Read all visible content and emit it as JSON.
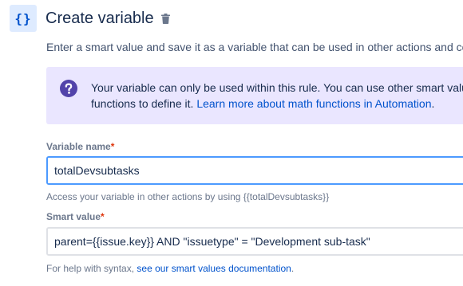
{
  "header": {
    "icon_glyph": "{}",
    "icon_name": "variable-icon",
    "title": "Create variable",
    "delete_icon": "trash-icon"
  },
  "description": "Enter a smart value and save it as a variable that can be used in other actions and co",
  "info": {
    "icon": "question-icon",
    "line1": "Your variable can only be used within this rule. You can use other smart valu",
    "line2_prefix": "functions to define it. ",
    "link_text": "Learn more about math functions in Automation",
    "line2_suffix": "."
  },
  "fields": {
    "variable_name": {
      "label": "Variable name",
      "required_mark": "*",
      "value": "totalDevsubtasks",
      "help": "Access your variable in other actions by using {{totalDevsubtasks}}"
    },
    "smart_value": {
      "label": "Smart value",
      "required_mark": "*",
      "value": "parent={{issue.key}} AND \"issuetype\" = \"Development sub-task\"",
      "help_prefix": "For help with syntax, ",
      "help_link": "see our smart values documentation",
      "help_suffix": "."
    }
  },
  "colors": {
    "accent": "#0052CC",
    "info_bg": "#EAE6FF",
    "info_icon": "#5243AA",
    "required": "#DE350B",
    "focus_border": "#4C9AFF"
  }
}
